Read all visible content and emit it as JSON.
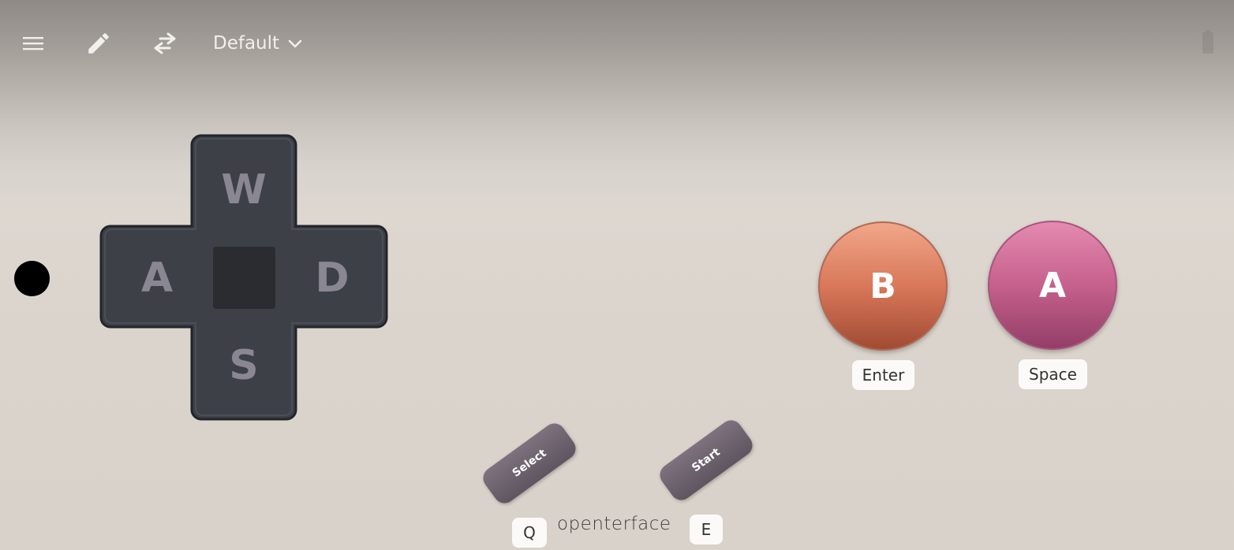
{
  "toolbar": {
    "icons": {
      "menu": "menu-icon",
      "edit": "pencil-icon",
      "swap": "swap-arrows-icon",
      "profile_dropdown": "chevron-down-icon",
      "status": "battery-icon"
    },
    "profile_label": "Default"
  },
  "dpad": {
    "up": "W",
    "left": "A",
    "right": "D",
    "down": "S"
  },
  "action_buttons": {
    "b": {
      "label": "B",
      "key": "Enter",
      "color": "#d9785a"
    },
    "a": {
      "label": "A",
      "key": "Space",
      "color": "#c5618c"
    }
  },
  "system_buttons": {
    "select": {
      "label": "Select",
      "key": "Q"
    },
    "start": {
      "label": "Start",
      "key": "E"
    }
  },
  "brand": "openterface",
  "colors": {
    "dpad_body": "#3d4047",
    "dpad_text": "#8b8792",
    "pill": "#6e646f"
  }
}
